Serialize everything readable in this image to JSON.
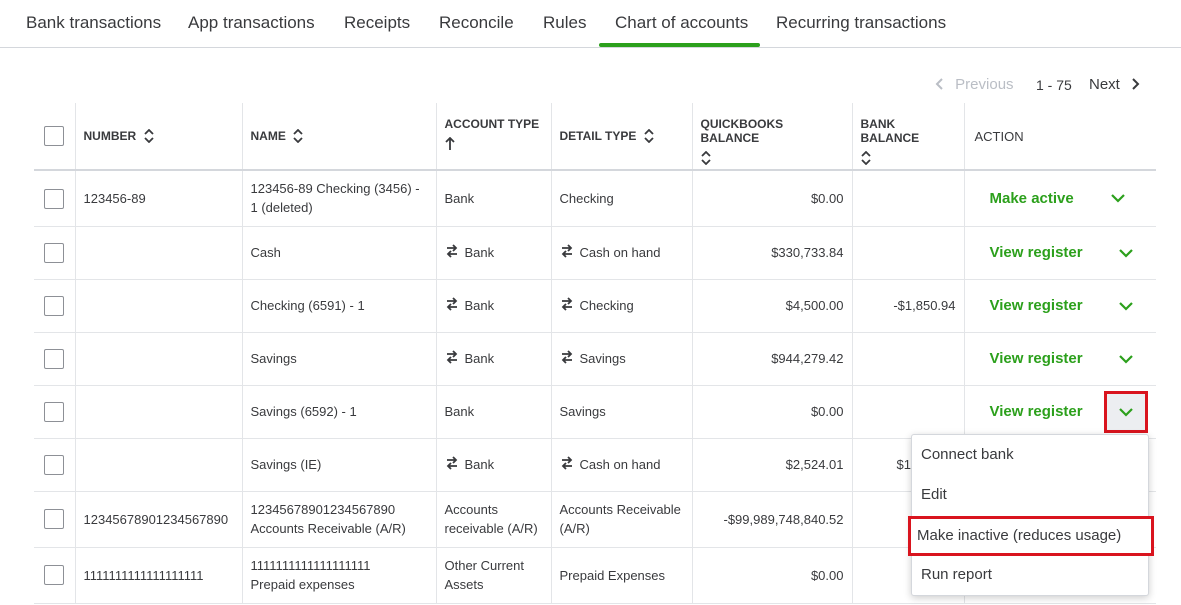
{
  "tabs": [
    {
      "label": "Bank transactions"
    },
    {
      "label": "App transactions"
    },
    {
      "label": "Receipts"
    },
    {
      "label": "Reconcile"
    },
    {
      "label": "Rules"
    },
    {
      "label": "Chart of accounts",
      "active": true
    },
    {
      "label": "Recurring transactions"
    }
  ],
  "pager": {
    "previous": "Previous",
    "range": "1 - 75",
    "next": "Next"
  },
  "columns": {
    "number": "NUMBER",
    "name": "NAME",
    "account_type": "ACCOUNT TYPE",
    "detail_type": "DETAIL TYPE",
    "qb_balance": "QUICKBOOKS BALANCE",
    "bank_balance": "BANK BALANCE",
    "action": "ACTION"
  },
  "rows": [
    {
      "number": "123456-89",
      "name": "123456-89 Checking (3456) - 1 (deleted)",
      "account_type": "Bank",
      "detail_type": "Checking",
      "qb_balance": "$0.00",
      "bank_balance": "",
      "action": "Make active",
      "bank_icon": false
    },
    {
      "number": "",
      "name": "Cash",
      "account_type": "Bank",
      "detail_type": "Cash on hand",
      "qb_balance": "$330,733.84",
      "bank_balance": "",
      "action": "View register",
      "bank_icon": true
    },
    {
      "number": "",
      "name": "Checking (6591) - 1",
      "account_type": "Bank",
      "detail_type": "Checking",
      "qb_balance": "$4,500.00",
      "bank_balance": "-$1,850.94",
      "action": "View register",
      "bank_icon": true
    },
    {
      "number": "",
      "name": "Savings",
      "account_type": "Bank",
      "detail_type": "Savings",
      "qb_balance": "$944,279.42",
      "bank_balance": "",
      "action": "View register",
      "bank_icon": true
    },
    {
      "number": "",
      "name": "Savings (6592) - 1",
      "account_type": "Bank",
      "detail_type": "Savings",
      "qb_balance": "$0.00",
      "bank_balance": "",
      "action": "View register",
      "bank_icon": false
    },
    {
      "number": "",
      "name": "Savings (IE)",
      "account_type": "Bank",
      "detail_type": "Cash on hand",
      "qb_balance": "$2,524.01",
      "bank_balance": "$1",
      "action": "",
      "bank_icon": true
    },
    {
      "number": "12345678901234567890",
      "name_line1": "12345678901234567890",
      "name_line2": "Accounts Receivable (A/R)",
      "type_line1": "Accounts",
      "type_line2": "receivable (A/R)",
      "detail_line1": "Accounts Receivable",
      "detail_line2": "(A/R)",
      "qb_balance": "-$99,989,748,840.52",
      "bank_balance": ""
    },
    {
      "number": "1111111111111111111",
      "name_line1": "1111111111111111111",
      "name_line2": "Prepaid expenses",
      "type_line1": "Other Current",
      "type_line2": "Assets",
      "detail_type": "Prepaid Expenses",
      "qb_balance": "$0.00",
      "bank_balance": ""
    }
  ],
  "menu": {
    "items": [
      {
        "label": "Connect bank"
      },
      {
        "label": "Edit"
      },
      {
        "label": "Make inactive (reduces usage)"
      },
      {
        "label": "Run report"
      }
    ]
  },
  "colors": {
    "accent": "#2ca01c",
    "highlight": "#d9141e"
  }
}
